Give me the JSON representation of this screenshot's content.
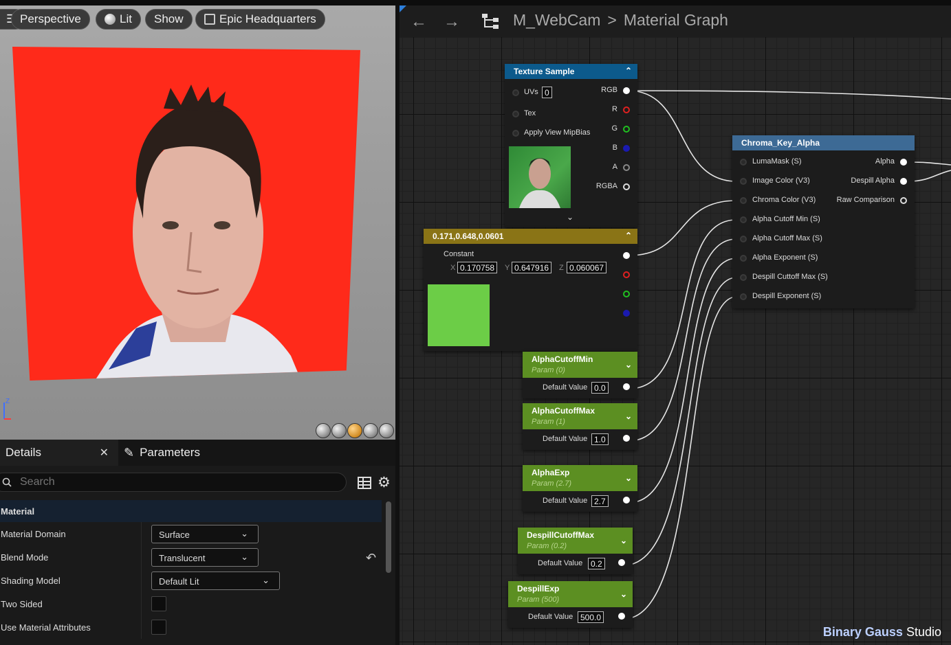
{
  "viewport": {
    "buttons": [
      {
        "label": "Perspective"
      },
      {
        "label": "Lit"
      },
      {
        "label": "Show"
      },
      {
        "label": "Epic Headquarters"
      }
    ],
    "axis_label": "Z"
  },
  "details": {
    "tabs": {
      "details": "Details",
      "parameters": "Parameters"
    },
    "search_placeholder": "Search",
    "section": "Material",
    "properties": [
      {
        "label": "Material Domain",
        "value": "Surface"
      },
      {
        "label": "Blend Mode",
        "value": "Translucent"
      },
      {
        "label": "Shading Model",
        "value": "Default Lit"
      },
      {
        "label": "Two Sided",
        "checked": false
      },
      {
        "label": "Use Material Attributes",
        "checked": false
      }
    ]
  },
  "graph": {
    "breadcrumb": {
      "material": "M_WebCam",
      "separator": ">",
      "view": "Material Graph"
    },
    "texture_sample": {
      "title": "Texture Sample",
      "inputs": [
        "UVs",
        "Tex",
        "Apply View MipBias"
      ],
      "uvs_value": "0",
      "outputs": [
        "RGB",
        "R",
        "G",
        "B",
        "A",
        "RGBA"
      ],
      "preview_color": "#3c8f3a"
    },
    "constant": {
      "title": "0.171,0.648,0.0601",
      "label": "Constant",
      "x": "0.170758",
      "y": "0.647916",
      "z": "0.060067",
      "x_label": "X",
      "y_label": "Y",
      "z_label": "Z",
      "swatch_color": "#6ccd47"
    },
    "chroma_key": {
      "title": "Chroma_Key_Alpha",
      "inputs": [
        "LumaMask (S)",
        "Image Color (V3)",
        "Chroma Color (V3)",
        "Alpha Cutoff Min (S)",
        "Alpha Cutoff Max (S)",
        "Alpha Exponent (S)",
        "Despill Cuttoff Max (S)",
        "Despill Exponent (S)"
      ],
      "outputs": [
        "Alpha",
        "Despill Alpha",
        "Raw Comparison"
      ]
    },
    "params": [
      {
        "name": "AlphaCutoffMin",
        "sub": "Param (0)",
        "default_label": "Default Value",
        "value": "0.0"
      },
      {
        "name": "AlphaCutoffMax",
        "sub": "Param (1)",
        "default_label": "Default Value",
        "value": "1.0"
      },
      {
        "name": "AlphaExp",
        "sub": "Param (2.7)",
        "default_label": "Default Value",
        "value": "2.7"
      },
      {
        "name": "DespillCutoffMax",
        "sub": "Param (0.2)",
        "default_label": "Default Value",
        "value": "0.2"
      },
      {
        "name": "DespillExp",
        "sub": "Param (500)",
        "default_label": "Default Value",
        "value": "500.0"
      }
    ],
    "watermark": {
      "brand": "Binary Gauss",
      "suffix": "Studio"
    }
  },
  "colors": {
    "texture_header": "#0c5a8c",
    "constant_header": "#8a7416",
    "chroma_header": "#3d6a95",
    "param_header": "#5c8f22",
    "video_background": "#ff2a1a"
  }
}
